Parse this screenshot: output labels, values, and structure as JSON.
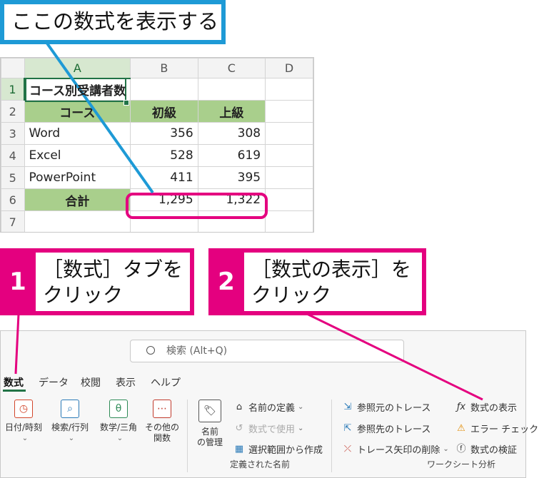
{
  "callouts": {
    "top": "ここの数式を表示する",
    "step1": {
      "num": "1",
      "text_line1": "［数式］タブを",
      "text_line2": "クリック"
    },
    "step2": {
      "num": "2",
      "text_line1": "［数式の表示］を",
      "text_line2": "クリック"
    }
  },
  "sheet": {
    "columns": [
      "A",
      "B",
      "C",
      "D"
    ],
    "rows": [
      {
        "n": "1",
        "cells": [
          "コース別受講者数",
          "",
          "",
          ""
        ]
      },
      {
        "n": "2",
        "cells": [
          "コース",
          "初級",
          "上級",
          ""
        ]
      },
      {
        "n": "3",
        "cells": [
          "Word",
          "356",
          "308",
          ""
        ]
      },
      {
        "n": "4",
        "cells": [
          "Excel",
          "528",
          "619",
          ""
        ]
      },
      {
        "n": "5",
        "cells": [
          "PowerPoint",
          "411",
          "395",
          ""
        ]
      },
      {
        "n": "6",
        "cells": [
          "合計",
          "1,295",
          "1,322",
          ""
        ]
      },
      {
        "n": "7",
        "cells": [
          "",
          "",
          "",
          ""
        ]
      }
    ]
  },
  "ribbon": {
    "search_placeholder": "検索 (Alt+Q)",
    "tabs": [
      "数式",
      "データ",
      "校閲",
      "表示",
      "ヘルプ"
    ],
    "function_library": {
      "datetime": "日付/時刻",
      "lookup": "検索/行列",
      "math": "数学/三角",
      "more_line1": "その他の",
      "more_line2": "関数"
    },
    "defined_names": {
      "name_manager_line1": "名前",
      "name_manager_line2": "の管理",
      "define_name": "名前の定義",
      "use_in_formula": "数式で使用",
      "create_from_selection": "選択範囲から作成",
      "group_label": "定義された名前"
    },
    "auditing": {
      "trace_precedents": "参照元のトレース",
      "trace_dependents": "参照先のトレース",
      "remove_arrows": "トレース矢印の削除",
      "show_formulas": "数式の表示",
      "error_check": "エラー チェック",
      "evaluate": "数式の検証",
      "group_label": "ワークシート分析"
    }
  },
  "colors": {
    "accent_pink": "#e4007f",
    "accent_blue": "#1e9ad6",
    "header_green": "#a9cf8c",
    "excel_green": "#217346"
  }
}
